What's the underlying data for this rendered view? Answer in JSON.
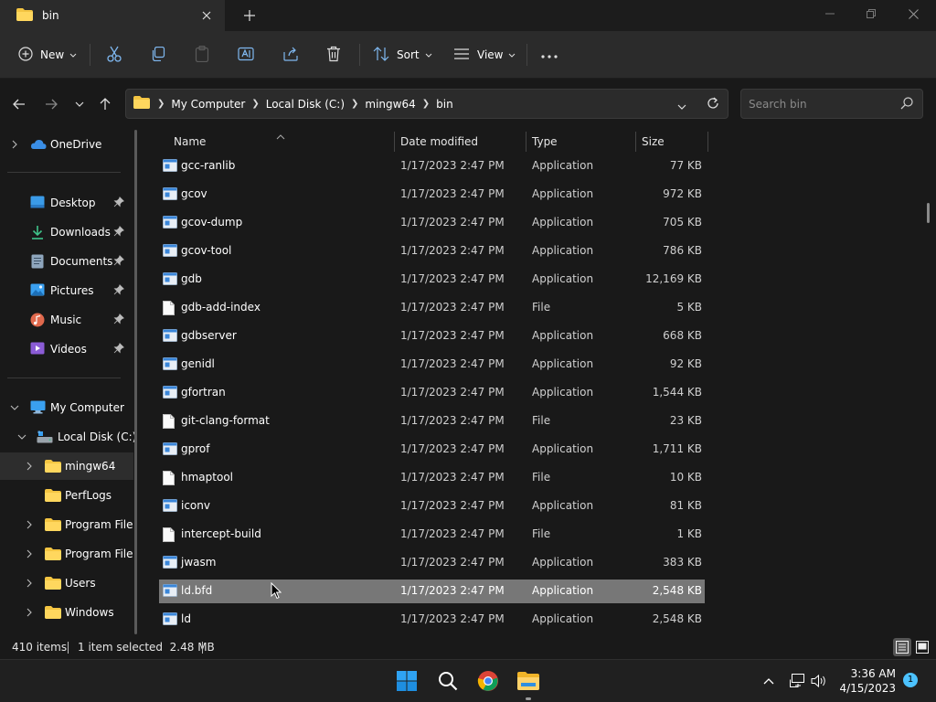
{
  "window": {
    "tab_title": "bin",
    "new_tab_icon": "plus-icon",
    "colors": {
      "bg": "#191919",
      "chrome": "#2b2b2b",
      "selected": "#777777",
      "accent": "#4cc2ff"
    }
  },
  "toolbar": {
    "new_label": "New",
    "sort_label": "Sort",
    "view_label": "View",
    "icons": [
      "cut-icon",
      "copy-icon",
      "paste-icon",
      "rename-icon",
      "share-icon",
      "delete-icon",
      "more-icon"
    ]
  },
  "address": {
    "crumbs": [
      "My Computer",
      "Local Disk (C:)",
      "mingw64",
      "bin"
    ],
    "search_placeholder": "Search bin"
  },
  "sidebar": {
    "onedrive": "OneDrive",
    "quick": [
      {
        "label": "Desktop"
      },
      {
        "label": "Downloads"
      },
      {
        "label": "Documents"
      },
      {
        "label": "Pictures"
      },
      {
        "label": "Music"
      },
      {
        "label": "Videos"
      }
    ],
    "computer": "My Computer",
    "drive": "Local Disk (C:)",
    "folders": [
      {
        "label": "mingw64",
        "selected": true
      },
      {
        "label": "PerfLogs"
      },
      {
        "label": "Program File"
      },
      {
        "label": "Program File"
      },
      {
        "label": "Users"
      },
      {
        "label": "Windows"
      }
    ]
  },
  "columns": {
    "name": "Name",
    "date": "Date modified",
    "type": "Type",
    "size": "Size"
  },
  "files": [
    {
      "name": "gcc-ranlib",
      "date": "1/17/2023 2:47 PM",
      "type": "Application",
      "size": "77 KB",
      "kind": "app"
    },
    {
      "name": "gcov",
      "date": "1/17/2023 2:47 PM",
      "type": "Application",
      "size": "972 KB",
      "kind": "app"
    },
    {
      "name": "gcov-dump",
      "date": "1/17/2023 2:47 PM",
      "type": "Application",
      "size": "705 KB",
      "kind": "app"
    },
    {
      "name": "gcov-tool",
      "date": "1/17/2023 2:47 PM",
      "type": "Application",
      "size": "786 KB",
      "kind": "app"
    },
    {
      "name": "gdb",
      "date": "1/17/2023 2:47 PM",
      "type": "Application",
      "size": "12,169 KB",
      "kind": "app"
    },
    {
      "name": "gdb-add-index",
      "date": "1/17/2023 2:47 PM",
      "type": "File",
      "size": "5 KB",
      "kind": "file"
    },
    {
      "name": "gdbserver",
      "date": "1/17/2023 2:47 PM",
      "type": "Application",
      "size": "668 KB",
      "kind": "app"
    },
    {
      "name": "genidl",
      "date": "1/17/2023 2:47 PM",
      "type": "Application",
      "size": "92 KB",
      "kind": "app"
    },
    {
      "name": "gfortran",
      "date": "1/17/2023 2:47 PM",
      "type": "Application",
      "size": "1,544 KB",
      "kind": "app"
    },
    {
      "name": "git-clang-format",
      "date": "1/17/2023 2:47 PM",
      "type": "File",
      "size": "23 KB",
      "kind": "file"
    },
    {
      "name": "gprof",
      "date": "1/17/2023 2:47 PM",
      "type": "Application",
      "size": "1,711 KB",
      "kind": "app"
    },
    {
      "name": "hmaptool",
      "date": "1/17/2023 2:47 PM",
      "type": "File",
      "size": "10 KB",
      "kind": "file"
    },
    {
      "name": "iconv",
      "date": "1/17/2023 2:47 PM",
      "type": "Application",
      "size": "81 KB",
      "kind": "app"
    },
    {
      "name": "intercept-build",
      "date": "1/17/2023 2:47 PM",
      "type": "File",
      "size": "1 KB",
      "kind": "file"
    },
    {
      "name": "jwasm",
      "date": "1/17/2023 2:47 PM",
      "type": "Application",
      "size": "383 KB",
      "kind": "app"
    },
    {
      "name": "ld.bfd",
      "date": "1/17/2023 2:47 PM",
      "type": "Application",
      "size": "2,548 KB",
      "kind": "app",
      "selected": true
    },
    {
      "name": "ld",
      "date": "1/17/2023 2:47 PM",
      "type": "Application",
      "size": "2,548 KB",
      "kind": "app"
    }
  ],
  "status": {
    "items_count": "410 items",
    "selection": "1 item selected  2.48 MB"
  },
  "taskbar": {
    "apps": [
      "windows-start-icon",
      "search-icon",
      "chrome-icon",
      "file-explorer-icon"
    ],
    "time": "3:36 AM",
    "date": "4/15/2023",
    "notification_count": "1"
  }
}
